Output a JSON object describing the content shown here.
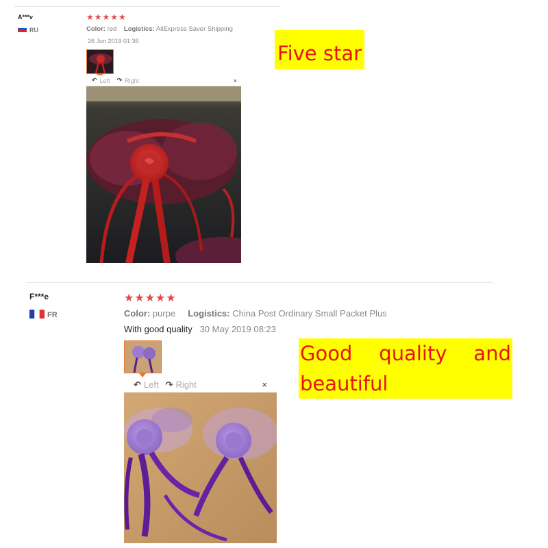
{
  "review1": {
    "user": "A***v",
    "country_code": "RU",
    "rating_stars": "★★★★★",
    "rating": 5,
    "color_label": "Color:",
    "color_value": "red",
    "logistics_label": "Logistics:",
    "logistics_value": "AliExpress Saver Shipping",
    "date": "26 Jun 2019 01:36",
    "viewer": {
      "left_label": "Left",
      "right_label": "Right",
      "close_glyph": "×"
    }
  },
  "review2": {
    "user": "F***e",
    "country_code": "FR",
    "rating_stars": "★★★★★",
    "rating": 5,
    "color_label": "Color:",
    "color_value": "purpe",
    "logistics_label": "Logistics:",
    "logistics_value": "China Post Ordinary Small Packet Plus",
    "comment": "With good quality",
    "date": "30 May 2019 08:23",
    "viewer": {
      "left_label": "Left",
      "right_label": "Right",
      "close_glyph": "×"
    }
  },
  "annotations": {
    "five_star": "Five star",
    "good_quality_line1": "Good quality and",
    "good_quality_line2": "beautiful"
  },
  "icons": {
    "rotate_left": "rotate-left-icon",
    "rotate_right": "rotate-right-icon",
    "close": "close-icon",
    "flag_ru": "flag-ru-icon",
    "flag_fr": "flag-fr-icon"
  },
  "colors": {
    "star": "#e64545",
    "thumb_border": "#e8762d",
    "callout_bg": "#ffff00",
    "callout_text": "#e81414"
  }
}
